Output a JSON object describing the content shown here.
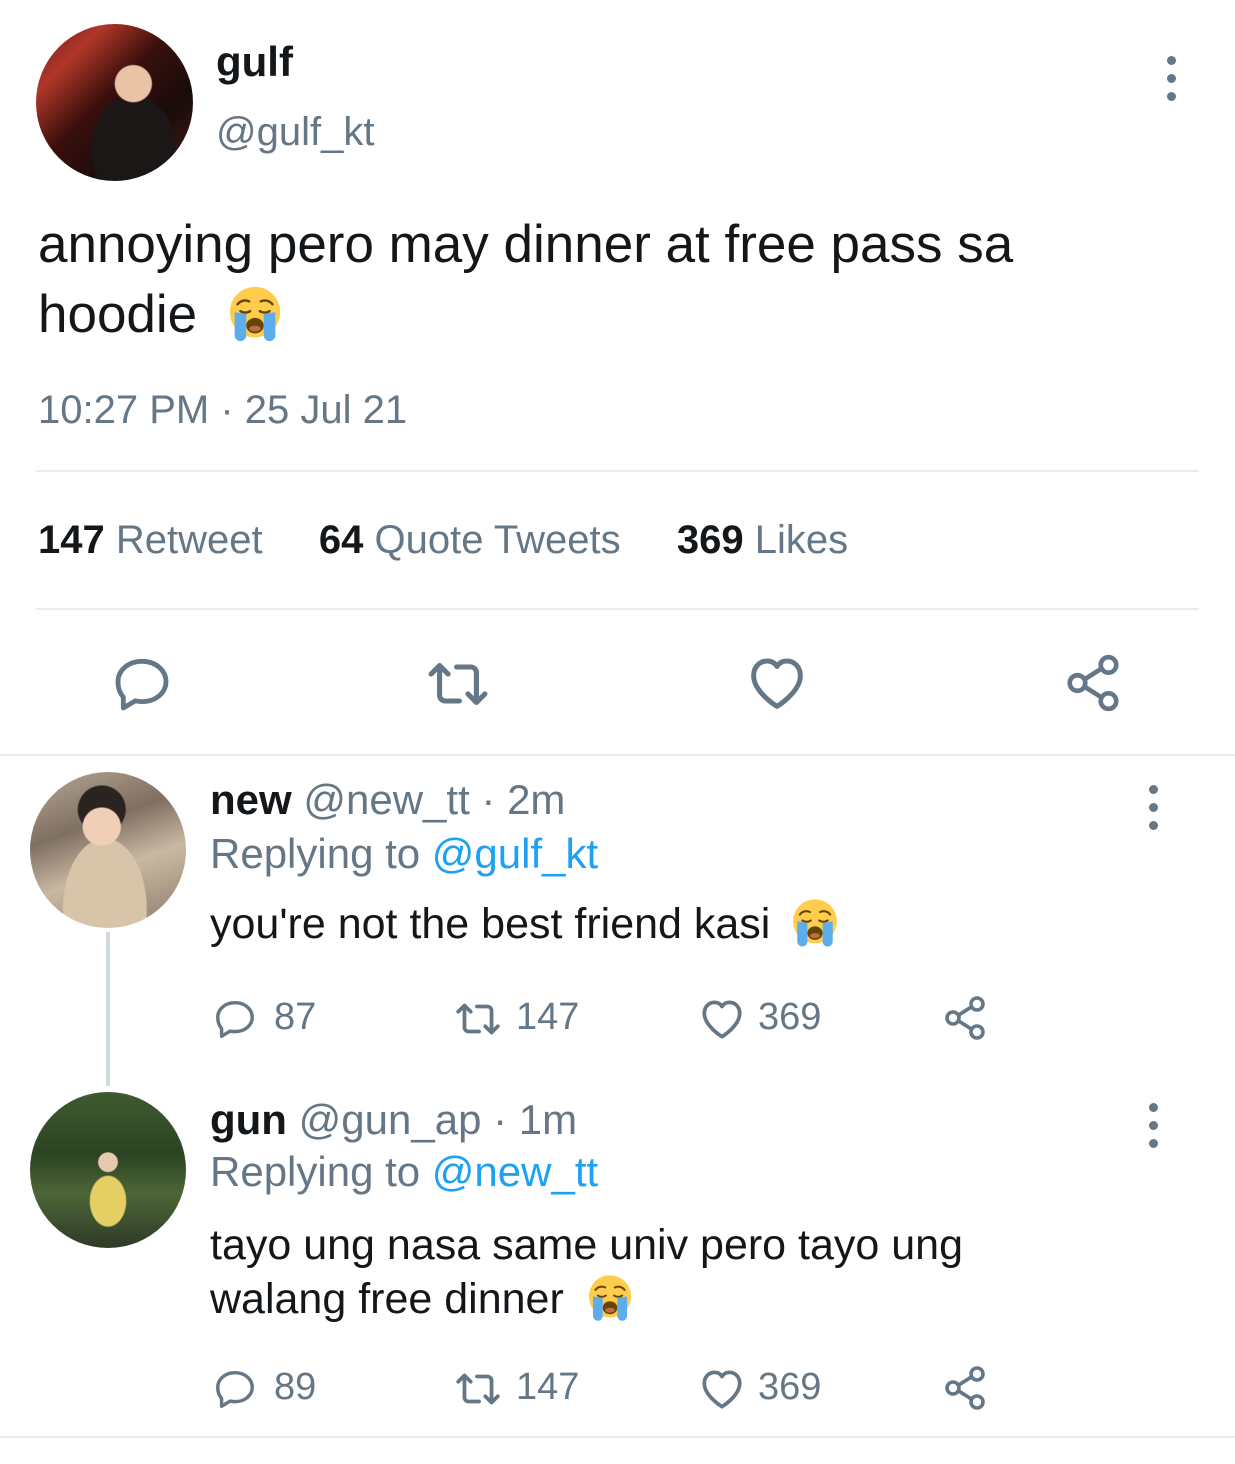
{
  "tweet": {
    "author_name": "gulf",
    "author_handle": "@gulf_kt",
    "text": "annoying pero may dinner at free pass sa",
    "text_line2": "hoodie",
    "timestamp": "10:27 PM · 25 Jul 21",
    "stats": {
      "retweets": "147",
      "retweets_label": "Retweet",
      "quotes": "64",
      "quotes_label": "Quote Tweets",
      "likes": "369",
      "likes_label": "Likes"
    }
  },
  "replies": [
    {
      "author_name": "new",
      "author_handle": "@new_tt",
      "time": "· 2m",
      "replying_prefix": "Replying to",
      "replying_to": "@gulf_kt",
      "text": "you're not the best friend kasi",
      "replies_count": "87",
      "retweets_count": "147",
      "likes_count": "369"
    },
    {
      "author_name": "gun",
      "author_handle": "@gun_ap",
      "time": "· 1m",
      "replying_prefix": "Replying to",
      "replying_to": "@new_tt",
      "text": "tayo ung nasa same univ pero tayo ung",
      "text_line2": "walang free dinner",
      "replies_count": "89",
      "retweets_count": "147",
      "likes_count": "369"
    }
  ],
  "icons": {
    "reply": "reply-icon",
    "retweet": "retweet-icon",
    "like": "heart-icon",
    "share": "share-icon",
    "emoji": "loudly-crying-face-emoji",
    "menu": "more-vertical-icon"
  },
  "colors": {
    "text": "#14171a",
    "muted": "#657786",
    "link": "#1da1f2",
    "divider": "#e6ecf0"
  }
}
